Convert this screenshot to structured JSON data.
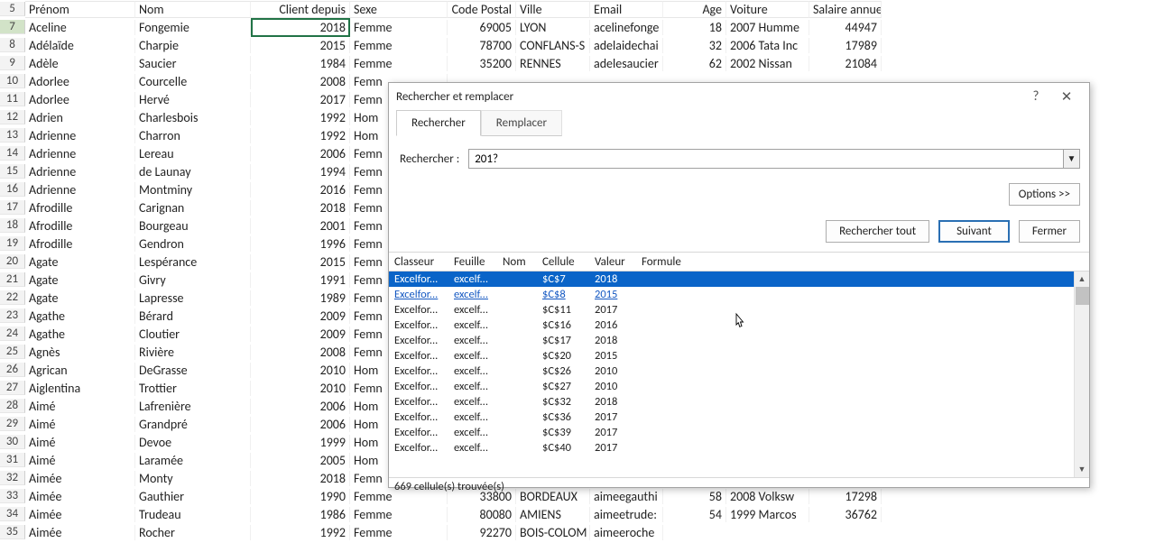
{
  "sheet": {
    "headers": [
      "Prénom",
      "Nom",
      "Client depuis",
      "Sexe",
      "Code Postal",
      "Ville",
      "Email",
      "Age",
      "Voiture",
      "Salaire annuel"
    ],
    "header_row_num": "5",
    "selected_row_num": "7",
    "rows": [
      {
        "n": "7",
        "cells": [
          "Aceline",
          "Fongemie",
          "2018",
          "Femme",
          "69005",
          "LYON",
          "acelinefonge",
          "18",
          "2007 Humme",
          "44947"
        ]
      },
      {
        "n": "8",
        "cells": [
          "Adélaïde",
          "Charpie",
          "2015",
          "Femme",
          "78700",
          "CONFLANS-S",
          "adelaidechai",
          "32",
          "2006 Tata Inc",
          "17989"
        ]
      },
      {
        "n": "9",
        "cells": [
          "Adèle",
          "Saucier",
          "1984",
          "Femme",
          "35200",
          "RENNES",
          "adelesaucier",
          "62",
          "2002 Nissan",
          "21084"
        ]
      },
      {
        "n": "10",
        "cells": [
          "Adorlee",
          "Courcelle",
          "2008",
          "Femn",
          "",
          "",
          "",
          "",
          "",
          ""
        ]
      },
      {
        "n": "11",
        "cells": [
          "Adorlee",
          "Hervé",
          "2017",
          "Femn",
          "",
          "",
          "",
          "",
          "",
          ""
        ]
      },
      {
        "n": "12",
        "cells": [
          "Adrien",
          "Charlesbois",
          "1992",
          "Hom",
          "",
          "",
          "",
          "",
          "",
          ""
        ]
      },
      {
        "n": "13",
        "cells": [
          "Adrienne",
          "Charron",
          "1992",
          "Hom",
          "",
          "",
          "",
          "",
          "",
          ""
        ]
      },
      {
        "n": "14",
        "cells": [
          "Adrienne",
          "Lereau",
          "2006",
          "Femn",
          "",
          "",
          "",
          "",
          "",
          ""
        ]
      },
      {
        "n": "15",
        "cells": [
          "Adrienne",
          "de Launay",
          "1994",
          "Femn",
          "",
          "",
          "",
          "",
          "",
          ""
        ]
      },
      {
        "n": "16",
        "cells": [
          "Adrienne",
          "Montminy",
          "2016",
          "Femn",
          "",
          "",
          "",
          "",
          "",
          ""
        ]
      },
      {
        "n": "17",
        "cells": [
          "Afrodille",
          "Carignan",
          "2018",
          "Femn",
          "",
          "",
          "",
          "",
          "",
          ""
        ]
      },
      {
        "n": "18",
        "cells": [
          "Afrodille",
          "Bourgeau",
          "2001",
          "Femn",
          "",
          "",
          "",
          "",
          "",
          ""
        ]
      },
      {
        "n": "19",
        "cells": [
          "Afrodille",
          "Gendron",
          "1996",
          "Femn",
          "",
          "",
          "",
          "",
          "",
          ""
        ]
      },
      {
        "n": "20",
        "cells": [
          "Agate",
          "Lespérance",
          "2015",
          "Femn",
          "",
          "",
          "",
          "",
          "",
          ""
        ]
      },
      {
        "n": "21",
        "cells": [
          "Agate",
          "Givry",
          "1991",
          "Femn",
          "",
          "",
          "",
          "",
          "",
          ""
        ]
      },
      {
        "n": "22",
        "cells": [
          "Agate",
          "Lapresse",
          "1989",
          "Femn",
          "",
          "",
          "",
          "",
          "",
          ""
        ]
      },
      {
        "n": "23",
        "cells": [
          "Agathe",
          "Bérard",
          "2009",
          "Femn",
          "",
          "",
          "",
          "",
          "",
          ""
        ]
      },
      {
        "n": "24",
        "cells": [
          "Agathe",
          "Cloutier",
          "2009",
          "Femn",
          "",
          "",
          "",
          "",
          "",
          ""
        ]
      },
      {
        "n": "25",
        "cells": [
          "Agnès",
          "Rivière",
          "2008",
          "Femn",
          "",
          "",
          "",
          "",
          "",
          ""
        ]
      },
      {
        "n": "26",
        "cells": [
          "Agrican",
          "DeGrasse",
          "2010",
          "Hom",
          "",
          "",
          "",
          "",
          "",
          ""
        ]
      },
      {
        "n": "27",
        "cells": [
          "Aiglentina",
          "Trottier",
          "2010",
          "Femn",
          "",
          "",
          "",
          "",
          "",
          ""
        ]
      },
      {
        "n": "28",
        "cells": [
          "Aimé",
          "Lafrenière",
          "2006",
          "Hom",
          "",
          "",
          "",
          "",
          "",
          ""
        ]
      },
      {
        "n": "29",
        "cells": [
          "Aimé",
          "Grandpré",
          "2006",
          "Hom",
          "",
          "",
          "",
          "",
          "",
          ""
        ]
      },
      {
        "n": "30",
        "cells": [
          "Aimé",
          "Devoe",
          "1999",
          "Hom",
          "",
          "",
          "",
          "",
          "",
          ""
        ]
      },
      {
        "n": "31",
        "cells": [
          "Aimé",
          "Laramée",
          "2005",
          "Hom",
          "",
          "",
          "",
          "",
          "",
          ""
        ]
      },
      {
        "n": "32",
        "cells": [
          "Aimée",
          "Monty",
          "2018",
          "Femn",
          "",
          "",
          "",
          "",
          "",
          ""
        ]
      },
      {
        "n": "33",
        "cells": [
          "Aimée",
          "Gauthier",
          "1990",
          "Femme",
          "33800",
          "BORDEAUX",
          "aimeegauthi",
          "58",
          "2008 Volksw",
          "17298"
        ]
      },
      {
        "n": "34",
        "cells": [
          "Aimée",
          "Trudeau",
          "1986",
          "Femme",
          "80080",
          "AMIENS",
          "aimeetrude:",
          "54",
          "1999 Marcos",
          "36762"
        ]
      },
      {
        "n": "35",
        "cells": [
          "Aimée",
          "Rocher",
          "1992",
          "Femme",
          "92270",
          "BOIS-COLOM",
          "aimeeroche",
          "",
          "",
          ""
        ]
      }
    ]
  },
  "dialog": {
    "title": "Rechercher et remplacer",
    "help_icon": "?",
    "close_icon": "✕",
    "tabs": {
      "search": "Rechercher",
      "replace": "Remplacer"
    },
    "search_label": "Rechercher :",
    "search_value": "201?",
    "options_btn": "Options >>",
    "findall_btn": "Rechercher tout",
    "next_btn": "Suivant",
    "close_btn": "Fermer",
    "results_headers": [
      "Classeur",
      "Feuille",
      "Nom",
      "Cellule",
      "Valeur",
      "Formule"
    ],
    "results": [
      {
        "wb": "Excelfor...",
        "sh": "excelf...",
        "nm": "",
        "cell": "$C$7",
        "val": "2018",
        "fm": "",
        "sel": true
      },
      {
        "wb": "Excelfor...",
        "sh": "excelf...",
        "nm": "",
        "cell": "$C$8",
        "val": "2015",
        "fm": "",
        "hover": true
      },
      {
        "wb": "Excelfor...",
        "sh": "excelf...",
        "nm": "",
        "cell": "$C$11",
        "val": "2017",
        "fm": ""
      },
      {
        "wb": "Excelfor...",
        "sh": "excelf...",
        "nm": "",
        "cell": "$C$16",
        "val": "2016",
        "fm": ""
      },
      {
        "wb": "Excelfor...",
        "sh": "excelf...",
        "nm": "",
        "cell": "$C$17",
        "val": "2018",
        "fm": ""
      },
      {
        "wb": "Excelfor...",
        "sh": "excelf...",
        "nm": "",
        "cell": "$C$20",
        "val": "2015",
        "fm": ""
      },
      {
        "wb": "Excelfor...",
        "sh": "excelf...",
        "nm": "",
        "cell": "$C$26",
        "val": "2010",
        "fm": ""
      },
      {
        "wb": "Excelfor...",
        "sh": "excelf...",
        "nm": "",
        "cell": "$C$27",
        "val": "2010",
        "fm": ""
      },
      {
        "wb": "Excelfor...",
        "sh": "excelf...",
        "nm": "",
        "cell": "$C$32",
        "val": "2018",
        "fm": ""
      },
      {
        "wb": "Excelfor...",
        "sh": "excelf...",
        "nm": "",
        "cell": "$C$36",
        "val": "2017",
        "fm": ""
      },
      {
        "wb": "Excelfor...",
        "sh": "excelf...",
        "nm": "",
        "cell": "$C$39",
        "val": "2017",
        "fm": ""
      },
      {
        "wb": "Excelfor...",
        "sh": "excelf...",
        "nm": "",
        "cell": "$C$40",
        "val": "2017",
        "fm": ""
      }
    ],
    "status": "669 cellule(s) trouvée(s)"
  }
}
